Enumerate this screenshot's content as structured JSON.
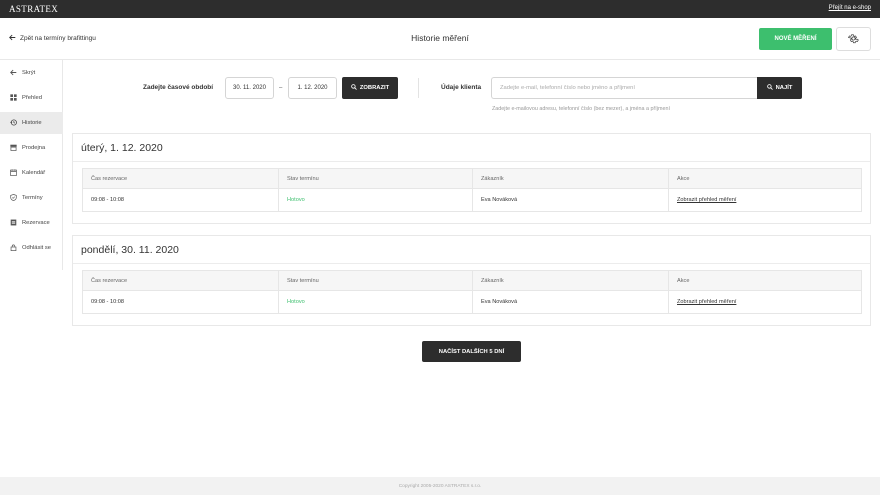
{
  "topbar": {
    "logo": "ASTRATEX",
    "eshop_link": "Přejít na e-shop"
  },
  "header": {
    "back_label": "Zpět na termíny brafittingu",
    "title": "Historie měření",
    "new_button": "NOVÉ MĚŘENÍ",
    "settings_icon": "gear-icon"
  },
  "sidebar": {
    "items": [
      {
        "label": "Skrýt",
        "icon": "arrow-left-icon",
        "active": false
      },
      {
        "label": "Přehled",
        "icon": "grid-icon",
        "active": false
      },
      {
        "label": "Historie",
        "icon": "history-icon",
        "active": true
      },
      {
        "label": "Prodejna",
        "icon": "store-icon",
        "active": false
      },
      {
        "label": "Kalendář",
        "icon": "calendar-icon",
        "active": false
      },
      {
        "label": "Termíny",
        "icon": "shield-icon",
        "active": false
      },
      {
        "label": "Rezervace",
        "icon": "list-icon",
        "active": false
      },
      {
        "label": "Odhlásit se",
        "icon": "lock-icon",
        "active": false
      }
    ]
  },
  "filter": {
    "period_label": "Zadejte časové období",
    "date_from": "30. 11. 2020",
    "date_separator": "–",
    "date_to": "1. 12. 2020",
    "show_button": "ZOBRAZIT",
    "client_label": "Údaje klienta",
    "search_placeholder": "Zadejte e-mail, telefonní číslo nebo jméno a příjmení",
    "search_value": "",
    "find_button": "NAJÍT",
    "hint": "Zadejte e-mailovou adresu, telefonní číslo (bez mezer), a jména a příjmení"
  },
  "table_headers": [
    "Čas rezervace",
    "Stav termínu",
    "Zákazník",
    "Akce"
  ],
  "days": [
    {
      "title": "úterý, 1. 12. 2020",
      "rows": [
        {
          "time": "09:08 - 10:08",
          "status": "Hotovo",
          "customer": "Eva Nováková",
          "action": "Zobrazit přehled měření"
        }
      ]
    },
    {
      "title": "pondělí, 30. 11. 2020",
      "rows": [
        {
          "time": "09:08 - 10:08",
          "status": "Hotovo",
          "customer": "Eva Nováková",
          "action": "Zobrazit přehled měření"
        }
      ]
    }
  ],
  "load_more_button": "NAČÍST DALŠÍCH 5 DNÍ",
  "footer": {
    "copyright": "Copyright 2005-2020 ASTRATEX s.r.o."
  },
  "colors": {
    "accent_green": "#3dbf6e",
    "dark": "#2d2d2d",
    "topbar": "#2d2d2d"
  }
}
